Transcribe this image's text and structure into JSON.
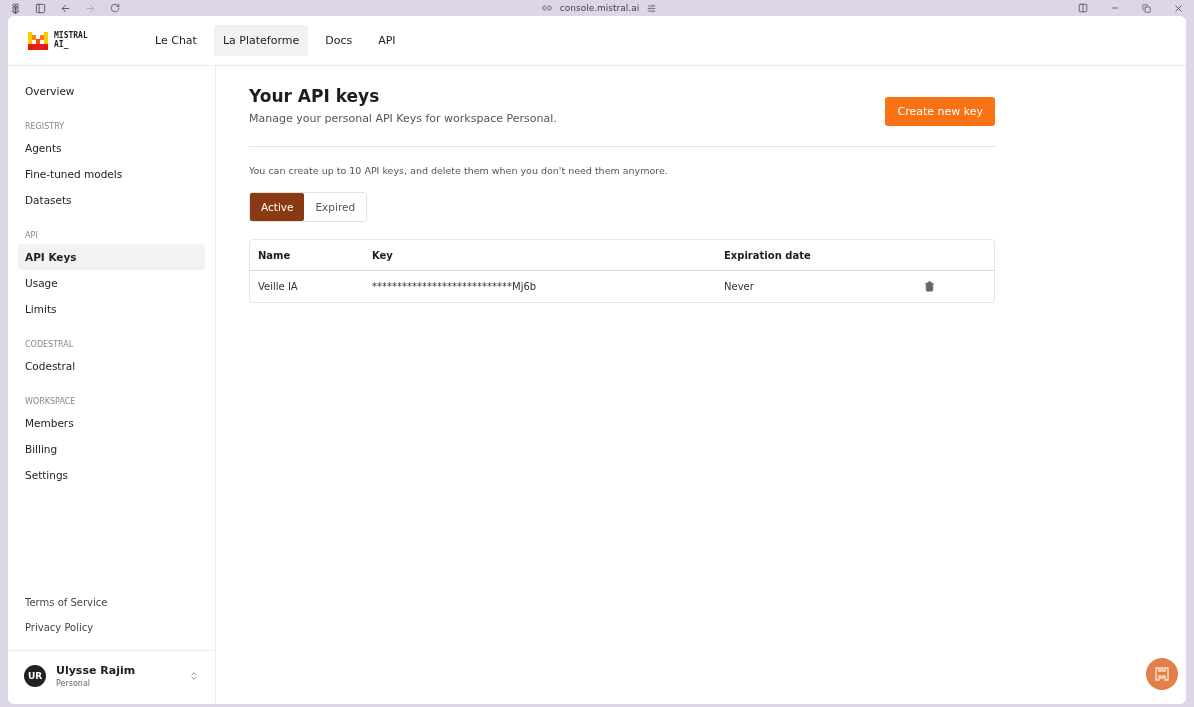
{
  "browser": {
    "url": "console.mistral.ai"
  },
  "header": {
    "logo": "MISTRAL AI_",
    "nav": [
      {
        "label": "Le Chat",
        "selected": false
      },
      {
        "label": "La Plateforme",
        "selected": true
      },
      {
        "label": "Docs",
        "selected": false
      },
      {
        "label": "API",
        "selected": false
      }
    ]
  },
  "sidebar": {
    "sections": [
      {
        "items": [
          {
            "label": "Overview",
            "selected": false
          }
        ]
      },
      {
        "title": "REGISTRY",
        "items": [
          {
            "label": "Agents",
            "selected": false
          },
          {
            "label": "Fine-tuned models",
            "selected": false
          },
          {
            "label": "Datasets",
            "selected": false
          }
        ]
      },
      {
        "title": "API",
        "items": [
          {
            "label": "API Keys",
            "selected": true
          },
          {
            "label": "Usage",
            "selected": false
          },
          {
            "label": "Limits",
            "selected": false
          }
        ]
      },
      {
        "title": "CODESTRAL",
        "items": [
          {
            "label": "Codestral",
            "selected": false
          }
        ]
      },
      {
        "title": "WORKSPACE",
        "items": [
          {
            "label": "Members",
            "selected": false
          },
          {
            "label": "Billing",
            "selected": false
          },
          {
            "label": "Settings",
            "selected": false
          }
        ]
      }
    ],
    "footer_links": [
      "Terms of Service",
      "Privacy Policy"
    ],
    "user": {
      "initials": "UR",
      "name": "Ulysse Rajim",
      "workspace": "Personal"
    }
  },
  "main": {
    "title": "Your API keys",
    "subtitle": "Manage your personal API Keys for workspace Personal.",
    "create_button": "Create new key",
    "note": "You can create up to 10 API keys, and delete them when you don't need them anymore.",
    "tabs": [
      {
        "label": "Active",
        "selected": true
      },
      {
        "label": "Expired",
        "selected": false
      }
    ],
    "table": {
      "columns": [
        "Name",
        "Key",
        "Expiration date"
      ],
      "rows": [
        {
          "name": "Veille IA",
          "key": "****************************Mj6b",
          "expiration": "Never"
        }
      ]
    }
  }
}
